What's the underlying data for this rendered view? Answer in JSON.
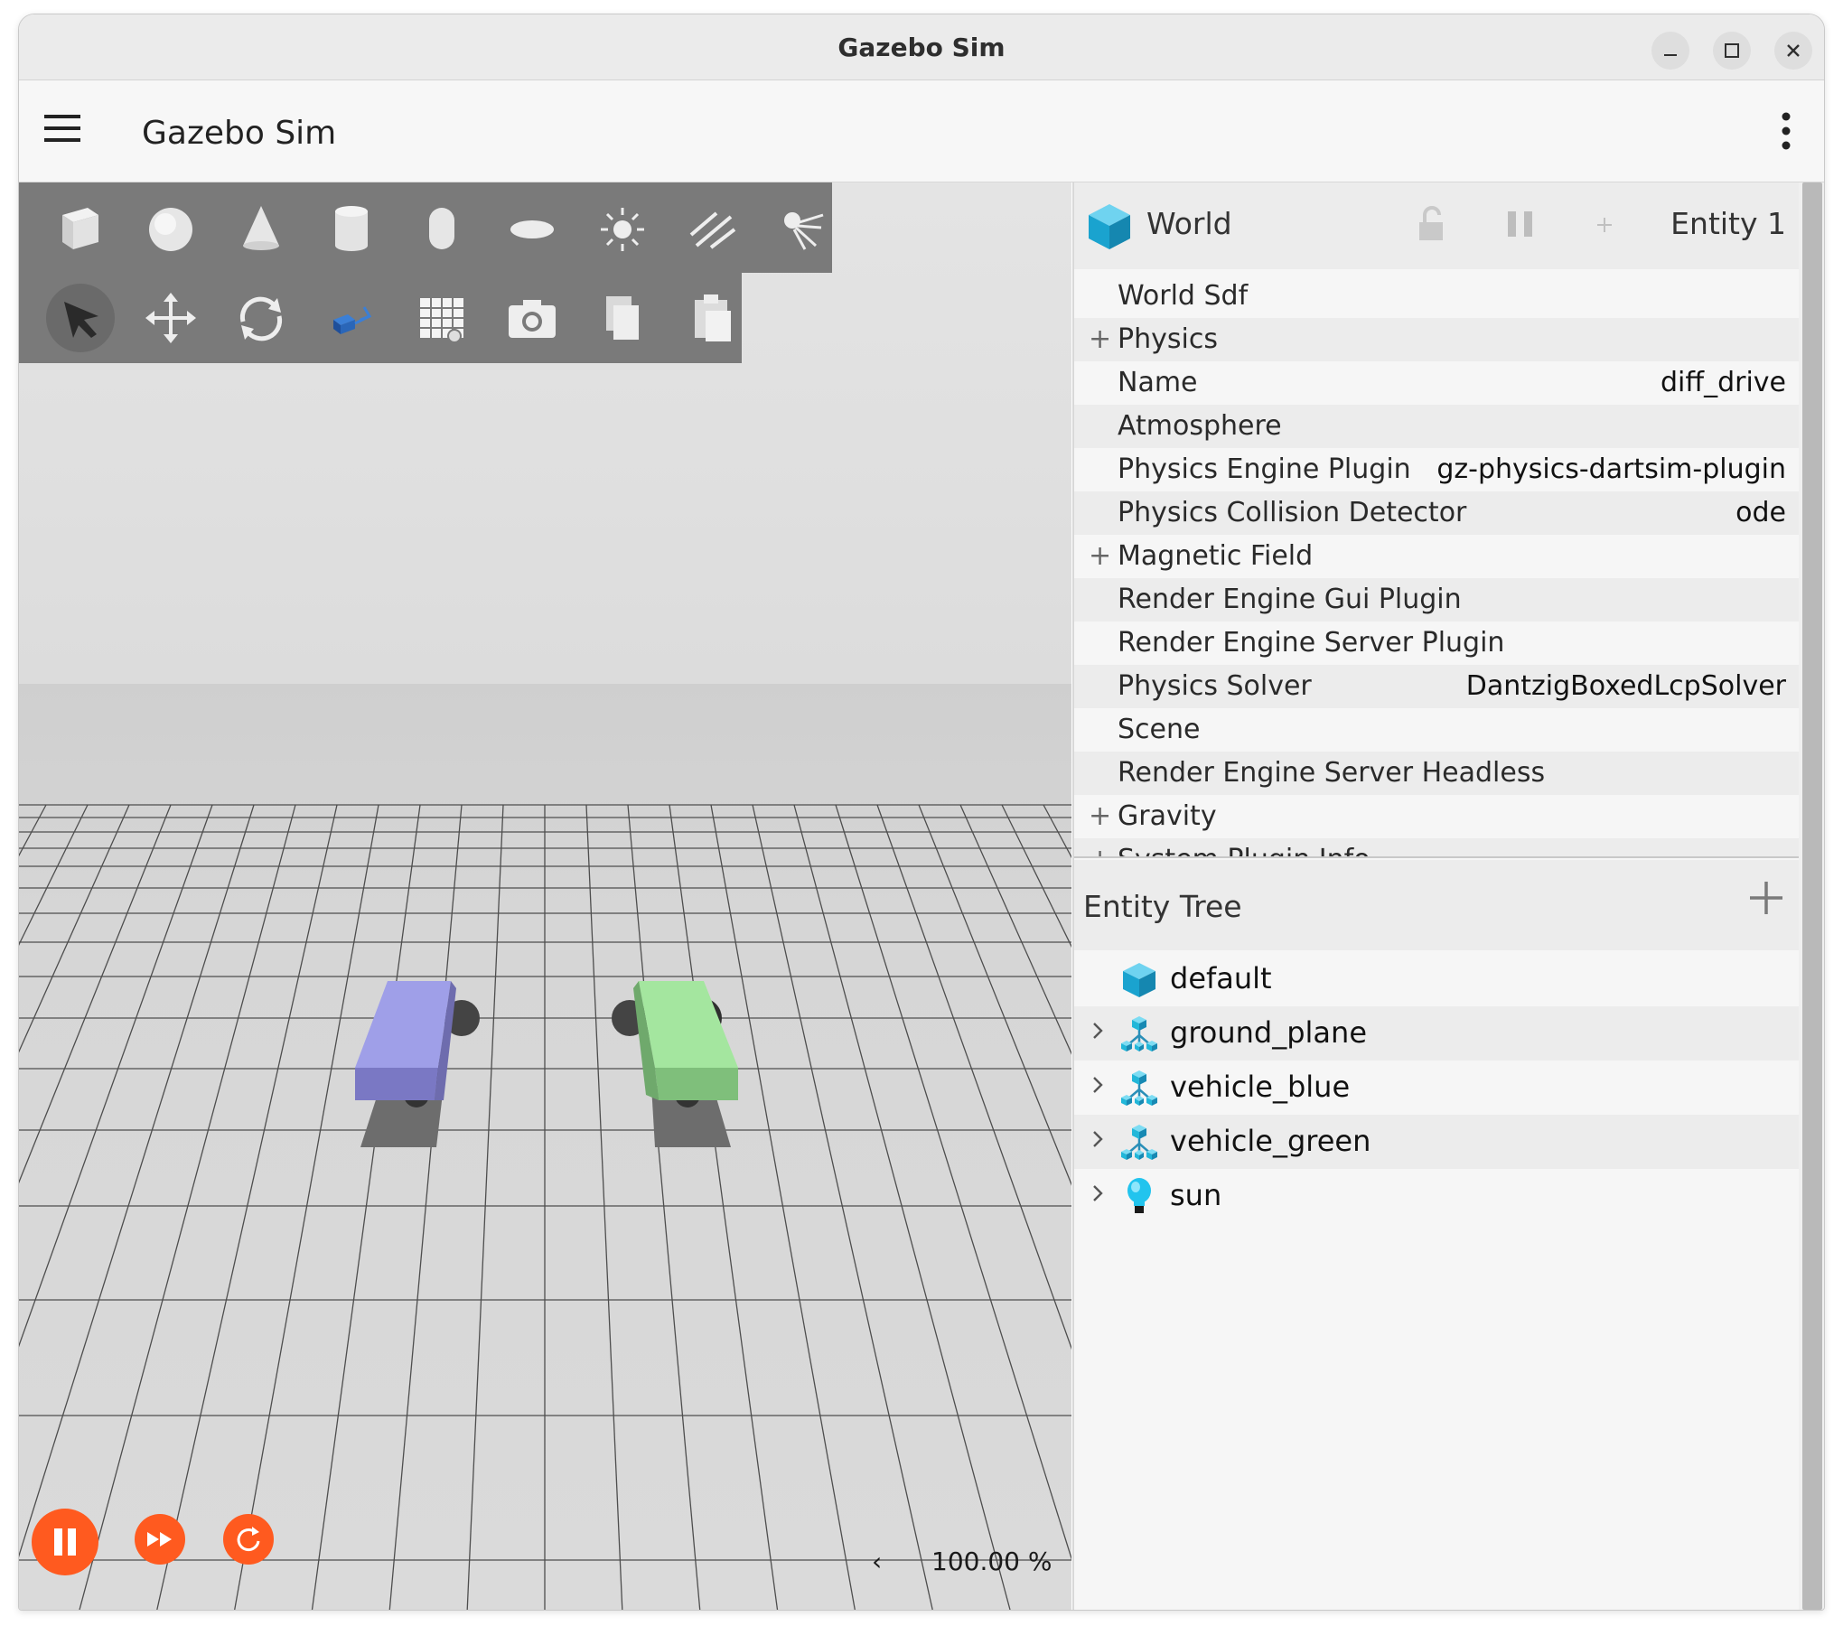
{
  "window": {
    "title": "Gazebo Sim"
  },
  "appbar": {
    "title": "Gazebo Sim"
  },
  "toolbar": {
    "shapes": [
      "box-icon",
      "sphere-icon",
      "cone-icon",
      "cylinder-icon",
      "capsule-icon",
      "ellipsoid-icon",
      "point-light-icon",
      "directional-light-icon",
      "spot-light-icon"
    ],
    "tools": [
      "select-icon",
      "translate-icon",
      "rotate-icon",
      "transform-control-icon",
      "grid-icon",
      "camera-icon",
      "copy-icon",
      "paste-icon"
    ]
  },
  "playback": {
    "zoom": "100.00 %",
    "arrow": "‹"
  },
  "component_inspector": {
    "title": "World",
    "entity": "Entity 1",
    "rows": [
      {
        "label": "World Sdf",
        "value": "",
        "expandable": false
      },
      {
        "label": "Physics",
        "value": "",
        "expandable": true
      },
      {
        "label": "Name",
        "value": "diff_drive",
        "expandable": false
      },
      {
        "label": "Atmosphere",
        "value": "",
        "expandable": false
      },
      {
        "label": "Physics Engine Plugin",
        "value": "gz-physics-dartsim-plugin",
        "expandable": false
      },
      {
        "label": "Physics Collision Detector",
        "value": "ode",
        "expandable": false
      },
      {
        "label": "Magnetic Field",
        "value": "",
        "expandable": true
      },
      {
        "label": "Render Engine Gui Plugin",
        "value": "",
        "expandable": false
      },
      {
        "label": "Render Engine Server Plugin",
        "value": "",
        "expandable": false
      },
      {
        "label": "Physics Solver",
        "value": "DantzigBoxedLcpSolver",
        "expandable": false
      },
      {
        "label": "Scene",
        "value": "",
        "expandable": false
      },
      {
        "label": "Render Engine Server Headless",
        "value": "",
        "expandable": false
      },
      {
        "label": "Gravity",
        "value": "",
        "expandable": true
      },
      {
        "label": "System Plugin Info",
        "value": "",
        "expandable": true
      }
    ]
  },
  "entity_tree": {
    "title": "Entity Tree",
    "items": [
      {
        "label": "default",
        "icon": "world-icon",
        "expandable": false
      },
      {
        "label": "ground_plane",
        "icon": "model-icon",
        "expandable": true
      },
      {
        "label": "vehicle_blue",
        "icon": "model-icon",
        "expandable": true
      },
      {
        "label": "vehicle_green",
        "icon": "model-icon",
        "expandable": true
      },
      {
        "label": "sun",
        "icon": "light-icon",
        "expandable": true
      }
    ]
  },
  "colors": {
    "accent": "#ff5a1f",
    "vehicle_blue": "#9f9fe8",
    "vehicle_green": "#a4e69f",
    "icon_cyan": "#22b7d9"
  }
}
